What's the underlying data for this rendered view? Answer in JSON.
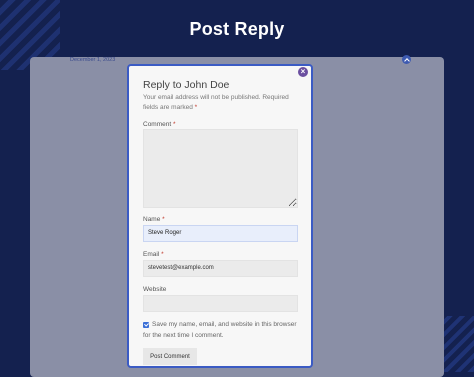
{
  "page": {
    "title": "Post Reply"
  },
  "card": {
    "date": "December 1, 2023"
  },
  "modal": {
    "title": "Reply to John Doe",
    "note": "Your email address will not be published. Required fields are marked",
    "required_mark": "*",
    "close_label": "×",
    "comment": {
      "label": "Comment",
      "value": ""
    },
    "name": {
      "label": "Name",
      "value": "Steve Roger"
    },
    "email": {
      "label": "Email",
      "value": "stevetest@example.com"
    },
    "website": {
      "label": "Website",
      "value": ""
    },
    "save_info": {
      "label": "Save my name, email, and website in this browser for the next time I comment.",
      "checked": true
    },
    "submit_label": "Post Comment"
  },
  "colors": {
    "background": "#14214f",
    "accent": "#3b5bc4",
    "close": "#6b4fa0"
  }
}
